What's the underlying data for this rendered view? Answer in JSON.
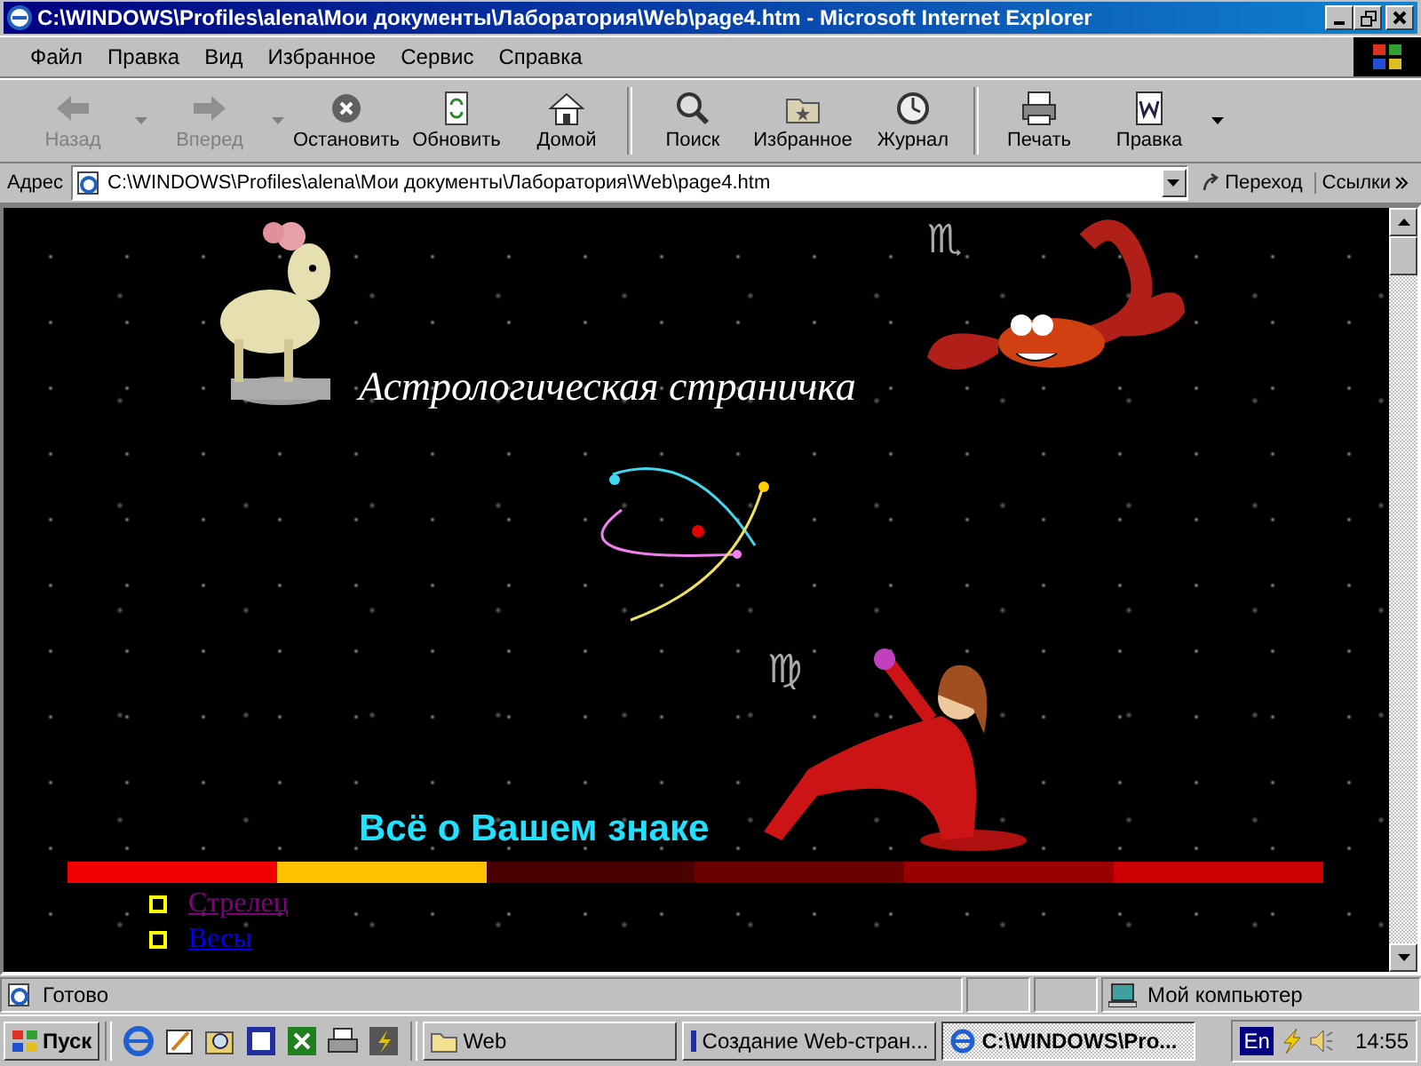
{
  "window": {
    "title": "C:\\WINDOWS\\Profiles\\alena\\Мои документы\\Лаборатория\\Web\\page4.htm - Microsoft Internet Explorer"
  },
  "menu": [
    "Файл",
    "Правка",
    "Вид",
    "Избранное",
    "Сервис",
    "Справка"
  ],
  "toolbar": [
    {
      "label": "Назад",
      "disabled": true,
      "dropdown": true
    },
    {
      "label": "Вперед",
      "disabled": true,
      "dropdown": true
    },
    {
      "label": "Остановить",
      "disabled": false,
      "dropdown": false
    },
    {
      "label": "Обновить",
      "disabled": false,
      "dropdown": false
    },
    {
      "label": "Домой",
      "disabled": false,
      "dropdown": false
    },
    {
      "label": "Поиск",
      "disabled": false,
      "dropdown": false
    },
    {
      "label": "Избранное",
      "disabled": false,
      "dropdown": false
    },
    {
      "label": "Журнал",
      "disabled": false,
      "dropdown": false
    },
    {
      "label": "Печать",
      "disabled": false,
      "dropdown": false
    },
    {
      "label": "Правка",
      "disabled": false,
      "dropdown": true
    }
  ],
  "address": {
    "label": "Адрес",
    "value": "C:\\WINDOWS\\Profiles\\alena\\Мои документы\\Лаборатория\\Web\\page4.htm",
    "go": "Переход",
    "links": "Ссылки"
  },
  "page": {
    "title": "Астрологическая страничка",
    "scorpio_symbol": "♏",
    "virgo_symbol": "♍",
    "subtitle": "Всё о Вашем знаке",
    "color_bar": [
      {
        "color": "#f00000"
      },
      {
        "color": "#ffc000"
      },
      {
        "color": "#4a0000"
      },
      {
        "color": "#6a0000"
      },
      {
        "color": "#9a0000"
      },
      {
        "color": "#cc0000"
      }
    ],
    "links": [
      {
        "text": "Стрелец",
        "visited": true
      },
      {
        "text": "Весы",
        "visited": false
      }
    ]
  },
  "status_bar": {
    "text": "Готово",
    "zone": "Мой компьютер"
  },
  "taskbar": {
    "start": "Пуск",
    "tasks": [
      {
        "label": "Web",
        "selected": false
      },
      {
        "label": "Создание Web-стран...",
        "selected": false
      },
      {
        "label": "C:\\WINDOWS\\Pro...",
        "selected": true
      }
    ],
    "language": "En",
    "clock": "14:55"
  }
}
